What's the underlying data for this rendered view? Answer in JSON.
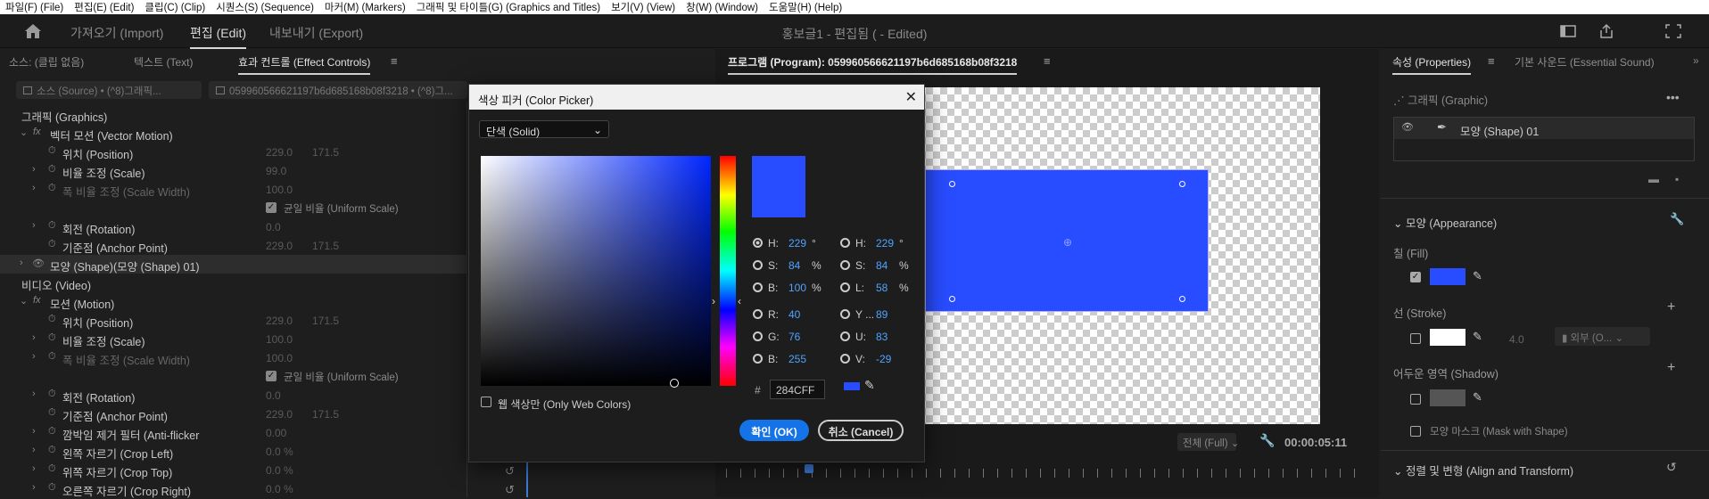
{
  "menu": [
    "파일(F) (File)",
    "편집(E) (Edit)",
    "클립(C) (Clip)",
    "시퀀스(S) (Sequence)",
    "마커(M) (Markers)",
    "그래픽 및 타이틀(G) (Graphics and Titles)",
    "보기(V) (View)",
    "창(W) (Window)",
    "도움말(H) (Help)"
  ],
  "workspace": {
    "tab_import": "가져오기 (Import)",
    "tab_edit": "편집 (Edit)",
    "tab_export": "내보내기 (Export)",
    "doc_title": "홍보글1 - 편집됨 ( - Edited)"
  },
  "left_panel": {
    "tab_source": "소스: (클립 없음)",
    "tab_text": "텍스트 (Text)",
    "tab_effects": "효과 컨트롤 (Effect Controls)",
    "menu": "≡",
    "source_select": "소스 (Source) • (^8)그래픽...",
    "seq_select": "059960566621197b6d685168b08f3218 • (^8)그...",
    "rows": [
      {
        "label": "그래픽 (Graphics)"
      },
      {
        "label": "벡터 모션 (Vector Motion)"
      },
      {
        "label": "위치 (Position)",
        "v1": "229.0",
        "v2": "171.5"
      },
      {
        "label": "비율 조정 (Scale)",
        "v1": "99.0"
      },
      {
        "label": "폭 비율 조정 (Scale Width)",
        "v1": "100.0"
      },
      {
        "label": "균일 비율 (Uniform Scale)"
      },
      {
        "label": "회전 (Rotation)",
        "v1": "0.0"
      },
      {
        "label": "기준점 (Anchor Point)",
        "v1": "229.0",
        "v2": "171.5"
      },
      {
        "label": "모양 (Shape)(모양 (Shape) 01)"
      },
      {
        "label": "비디오 (Video)"
      },
      {
        "label": "모션 (Motion)"
      },
      {
        "label": "위치 (Position)",
        "v1": "229.0",
        "v2": "171.5"
      },
      {
        "label": "비율 조정 (Scale)",
        "v1": "100.0"
      },
      {
        "label": "폭 비율 조정 (Scale Width)",
        "v1": "100.0"
      },
      {
        "label": "균일 비율 (Uniform Scale)"
      },
      {
        "label": "회전 (Rotation)",
        "v1": "0.0"
      },
      {
        "label": "기준점 (Anchor Point)",
        "v1": "229.0",
        "v2": "171.5"
      },
      {
        "label": "깜박임 제거 필터 (Anti-flicker",
        "v1": "0.00"
      },
      {
        "label": "왼쪽 자르기 (Crop Left)",
        "v1": "0.0 %"
      },
      {
        "label": "위쪽 자르기 (Crop Top)",
        "v1": "0.0 %"
      },
      {
        "label": "오른쪽 자르기 (Crop Right)",
        "v1": "0.0 %"
      }
    ]
  },
  "program": {
    "title": "프로그램 (Program): 059960566621197b6d685168b08f3218",
    "menu": "≡",
    "fit": "전체 (Full)",
    "timecode": "00:00:05:11",
    "shape_color": "#284CFF"
  },
  "dialog": {
    "title": "색상 피커 (Color Picker)",
    "mode": "단색 (Solid)",
    "hsb": [
      {
        "l": "H:",
        "v": "229",
        "u": "°"
      },
      {
        "l": "S:",
        "v": "84",
        "u": "%"
      },
      {
        "l": "B:",
        "v": "100",
        "u": "%"
      }
    ],
    "hsl": [
      {
        "l": "H:",
        "v": "229",
        "u": "°"
      },
      {
        "l": "S:",
        "v": "84",
        "u": "%"
      },
      {
        "l": "L:",
        "v": "58",
        "u": "%"
      }
    ],
    "rgb": [
      {
        "l": "R:",
        "v": "40"
      },
      {
        "l": "G:",
        "v": "76"
      },
      {
        "l": "B:",
        "v": "255"
      }
    ],
    "yuv": [
      {
        "l": "Y ...",
        "v": "89"
      },
      {
        "l": "U:",
        "v": "83"
      },
      {
        "l": "V:",
        "v": "-29"
      }
    ],
    "hex_label": "#",
    "hex": "284CFF",
    "web_only": "웹 색상만 (Only Web Colors)",
    "ok": "확인 (OK)",
    "cancel": "취소 (Cancel)",
    "color": "#284CFF"
  },
  "properties": {
    "tab_properties": "속성 (Properties)",
    "tab_sound": "기본 사운드 (Essential Sound)",
    "menu": "≡",
    "graphic": "그래픽 (Graphic)",
    "layer": "모양 (Shape) 01",
    "appearance": "모양 (Appearance)",
    "fill": "칠 (Fill)",
    "stroke": "선 (Stroke)",
    "stroke_width": "4.0",
    "stroke_pos": "외부 (O...",
    "shadow": "어두운 영역 (Shadow)",
    "mask": "모양 마스크 (Mask with Shape)",
    "align": "정렬 및 변형 (Align and Transform)",
    "fill_color": "#284CFF",
    "stroke_color": "#FFFFFF",
    "shadow_color": "#555555"
  }
}
